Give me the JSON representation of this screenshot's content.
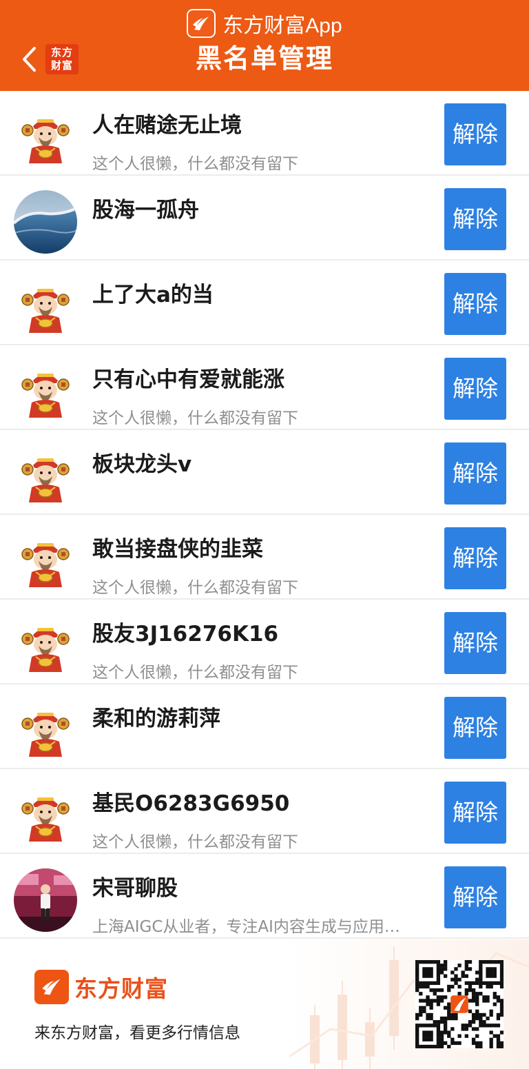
{
  "header": {
    "app_name": "东方财富App",
    "mini_logo_line1": "东方",
    "mini_logo_line2": "财富",
    "title": "黑名单管理",
    "background_color": "#ec5a14"
  },
  "list": {
    "remove_label": "解除",
    "remove_button_color": "#2d81e2",
    "items": [
      {
        "name": "人在赌途无止境",
        "bio": "这个人很懒，什么都没有留下",
        "avatar": "fortune-god-avatar"
      },
      {
        "name": "股海一孤舟",
        "bio": "",
        "avatar": "ocean-wave-avatar"
      },
      {
        "name": "上了大a的当",
        "bio": "",
        "avatar": "fortune-god-avatar"
      },
      {
        "name": "只有心中有爱就能涨",
        "bio": "这个人很懒，什么都没有留下",
        "avatar": "fortune-god-avatar"
      },
      {
        "name": "板块龙头v",
        "bio": "",
        "avatar": "fortune-god-avatar"
      },
      {
        "name": "敢当接盘侠的韭菜",
        "bio": "这个人很懒，什么都没有留下",
        "avatar": "fortune-god-avatar"
      },
      {
        "name": "股友3J16276K16",
        "bio": "这个人很懒，什么都没有留下",
        "avatar": "fortune-god-avatar"
      },
      {
        "name": "柔和的游莉萍",
        "bio": "",
        "avatar": "fortune-god-avatar"
      },
      {
        "name": "基民O6283G6950",
        "bio": "这个人很懒，什么都没有留下",
        "avatar": "fortune-god-avatar"
      },
      {
        "name": "宋哥聊股",
        "bio": "上海AIGC从业者，专注AI内容生成与应用…",
        "avatar": "stage-photo-avatar"
      }
    ]
  },
  "footer": {
    "brand_name": "东方财富",
    "slogan": "来东方财富，看更多行情信息",
    "qr_icon": "qr-code-icon"
  }
}
